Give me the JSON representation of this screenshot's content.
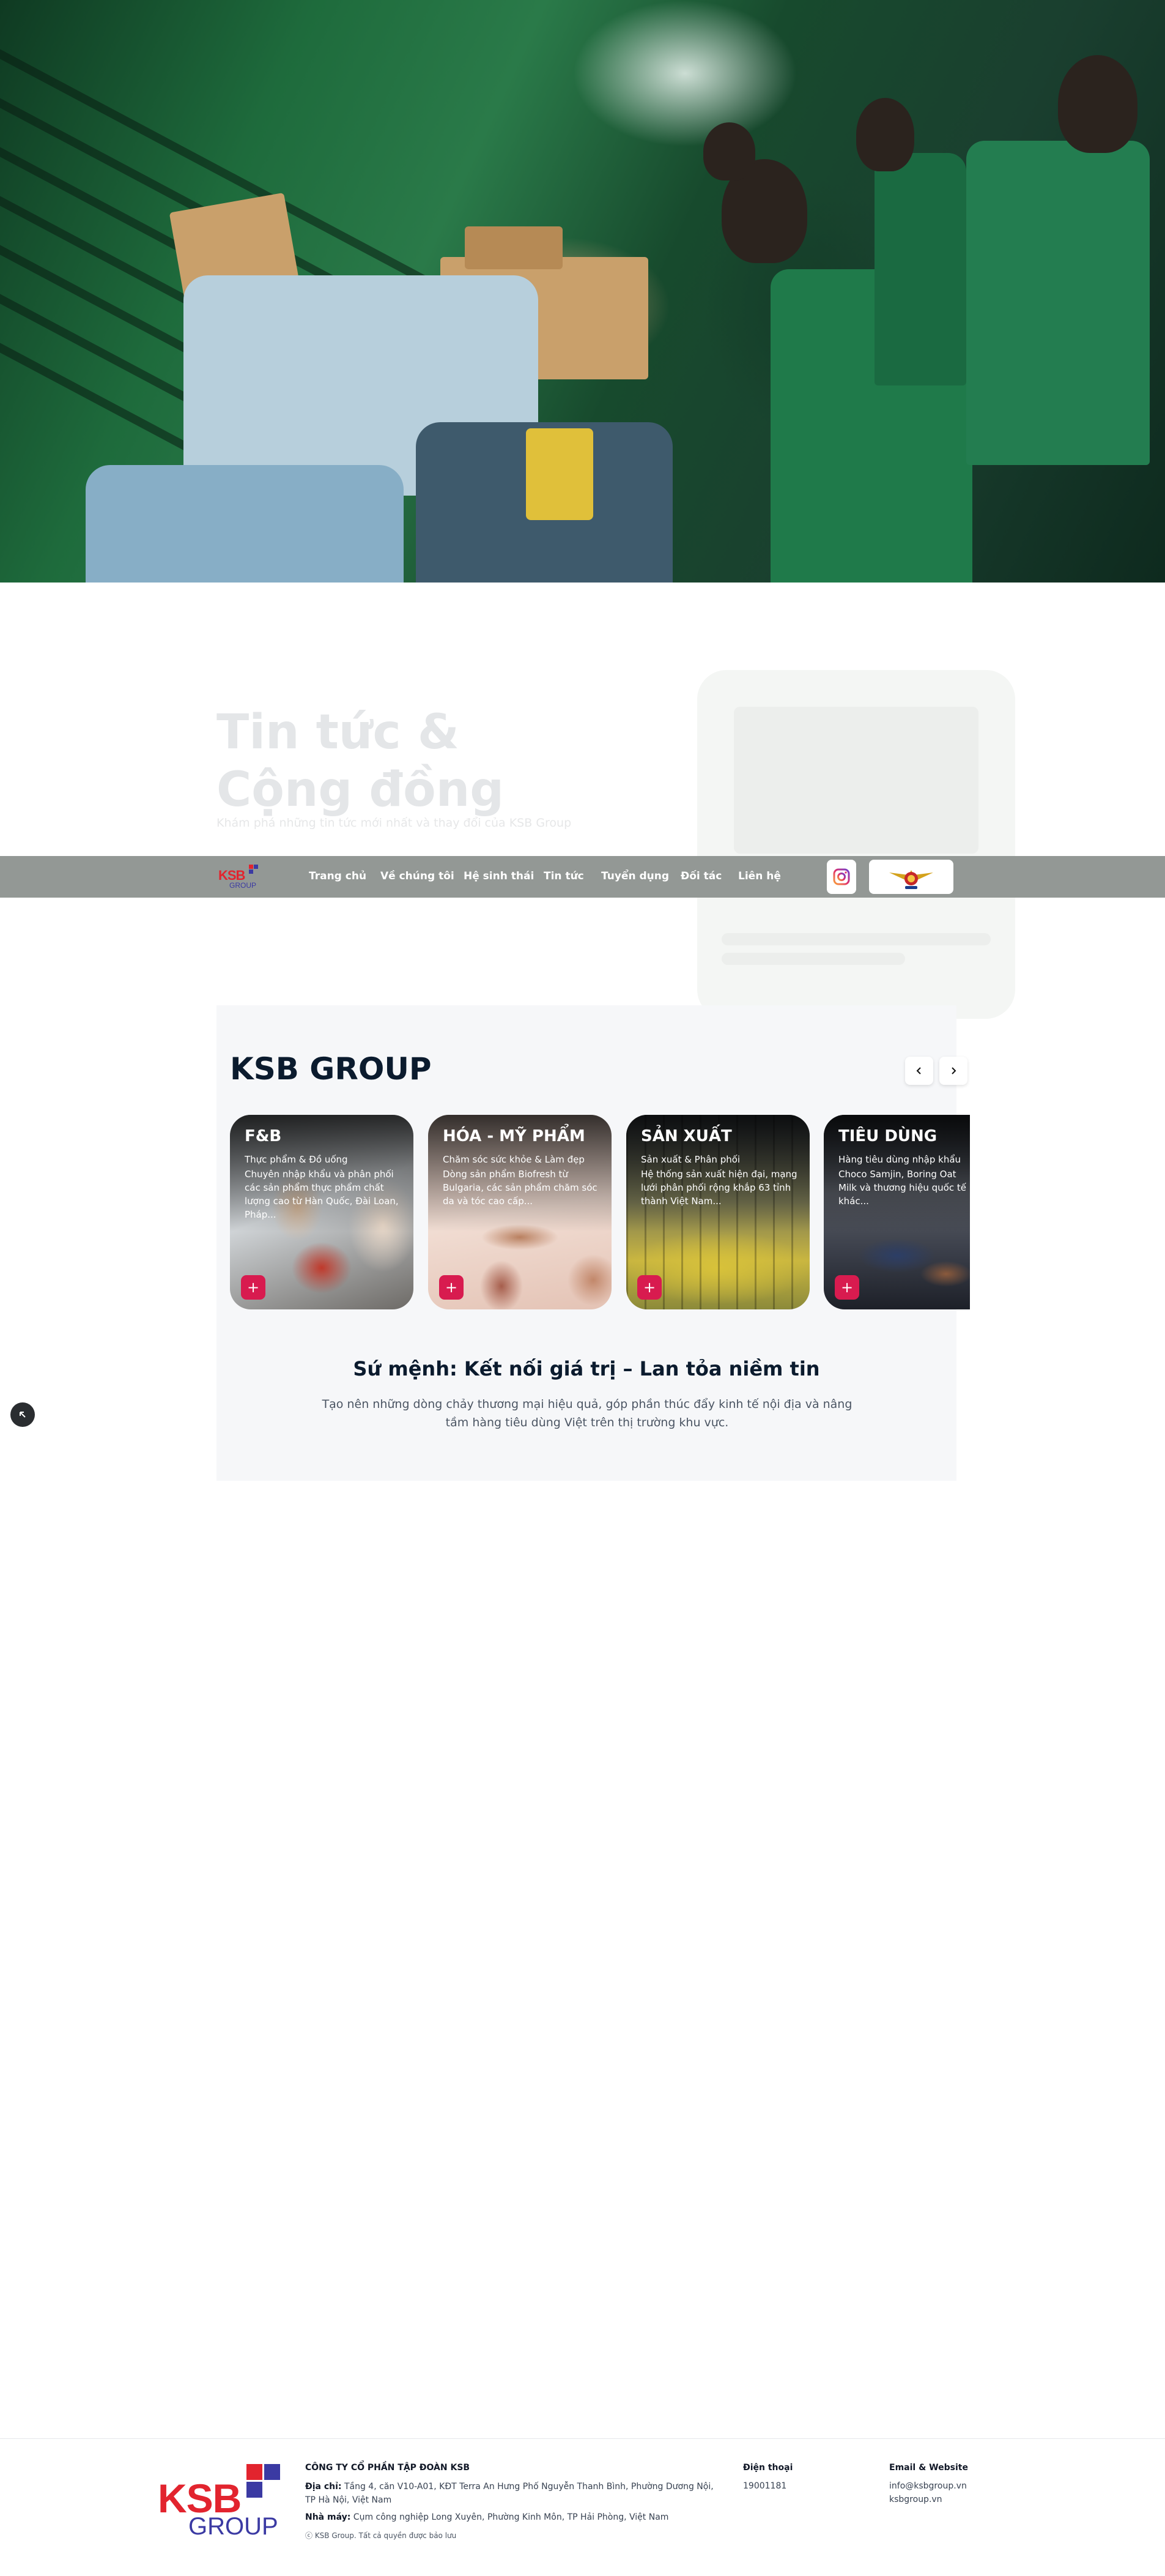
{
  "hero": {
    "image_alt": "warehouse-workers-photo"
  },
  "news": {
    "title_line1": "Tin tức &",
    "title_line2": "Cộng đồng",
    "subtitle": "Khám phá những tin tức mới nhất và thay đổi của KSB Group"
  },
  "nav": {
    "logo_top": "KSB",
    "logo_bottom": "GROUP",
    "items": [
      "Trang chủ",
      "Về chúng tôi",
      "Hệ sinh thái",
      "Tin tức",
      "Tuyển dụng",
      "Đối tác",
      "Liên hệ"
    ]
  },
  "brand": {
    "accent": "#d81b4f",
    "logo_red": "#e2242e",
    "logo_blue": "#3b3aa3",
    "nav_bg": "#939895"
  },
  "ecosystem": {
    "title": "KSB GROUP",
    "cards": [
      {
        "title": "F&B",
        "category": "Thực phẩm & Đồ uống",
        "description": "Chuyên nhập khẩu và phân phối các sản phẩm thực phẩm chất lượng cao từ Hàn Quốc, Đài Loan, Pháp...",
        "button": "+"
      },
      {
        "title": "HÓA - MỸ PHẨM",
        "category": "Chăm sóc sức khỏe & Làm đẹp",
        "description": "Dòng sản phẩm Biofresh từ Bulgaria, các sản phẩm chăm sóc da và tóc cao cấp...",
        "button": "+"
      },
      {
        "title": "SẢN XUẤT",
        "category": "Sản xuất & Phân phối",
        "description": "Hệ thống sản xuất hiện đại, mạng lưới phân phối rộng khắp 63 tỉnh thành Việt Nam...",
        "button": "+"
      },
      {
        "title": "TIÊU DÙNG",
        "category": "Hàng tiêu dùng nhập khẩu",
        "description": "Choco Samjin, Boring Oat Milk và thương hiệu quốc tế khác...",
        "button": "+"
      }
    ],
    "mission_title": "Sứ mệnh: Kết nối giá trị – Lan tỏa niềm tin",
    "mission_text": "Tạo nên những dòng chảy thương mại hiệu quả, góp phần thúc đẩy kinh tế nội địa và nâng tầm hàng tiêu dùng Việt trên thị trường khu vực."
  },
  "footer": {
    "logo_top": "KSB",
    "logo_bottom": "GROUP",
    "company": "CÔNG TY CỔ PHẦN TẬP ĐOÀN KSB",
    "address_label": "Địa chỉ:",
    "address": "Tầng 4, căn V10-A01, KĐT Terra An Hưng Phố Nguyễn Thanh Bình, Phường Dương Nội, TP Hà Nội, Việt Nam",
    "factory_label": "Nhà máy:",
    "factory": "Cụm công nghiệp Long Xuyên, Phường Kinh Môn, TP Hải Phòng, Việt Nam",
    "copyright": "ⓒ KSB Group. Tất cả quyền được bảo lưu",
    "phone_label": "Điện thoại",
    "phone": "19001181",
    "email_label": "Email & Website",
    "email": "info@ksbgroup.vn",
    "website": "ksbgroup.vn"
  }
}
